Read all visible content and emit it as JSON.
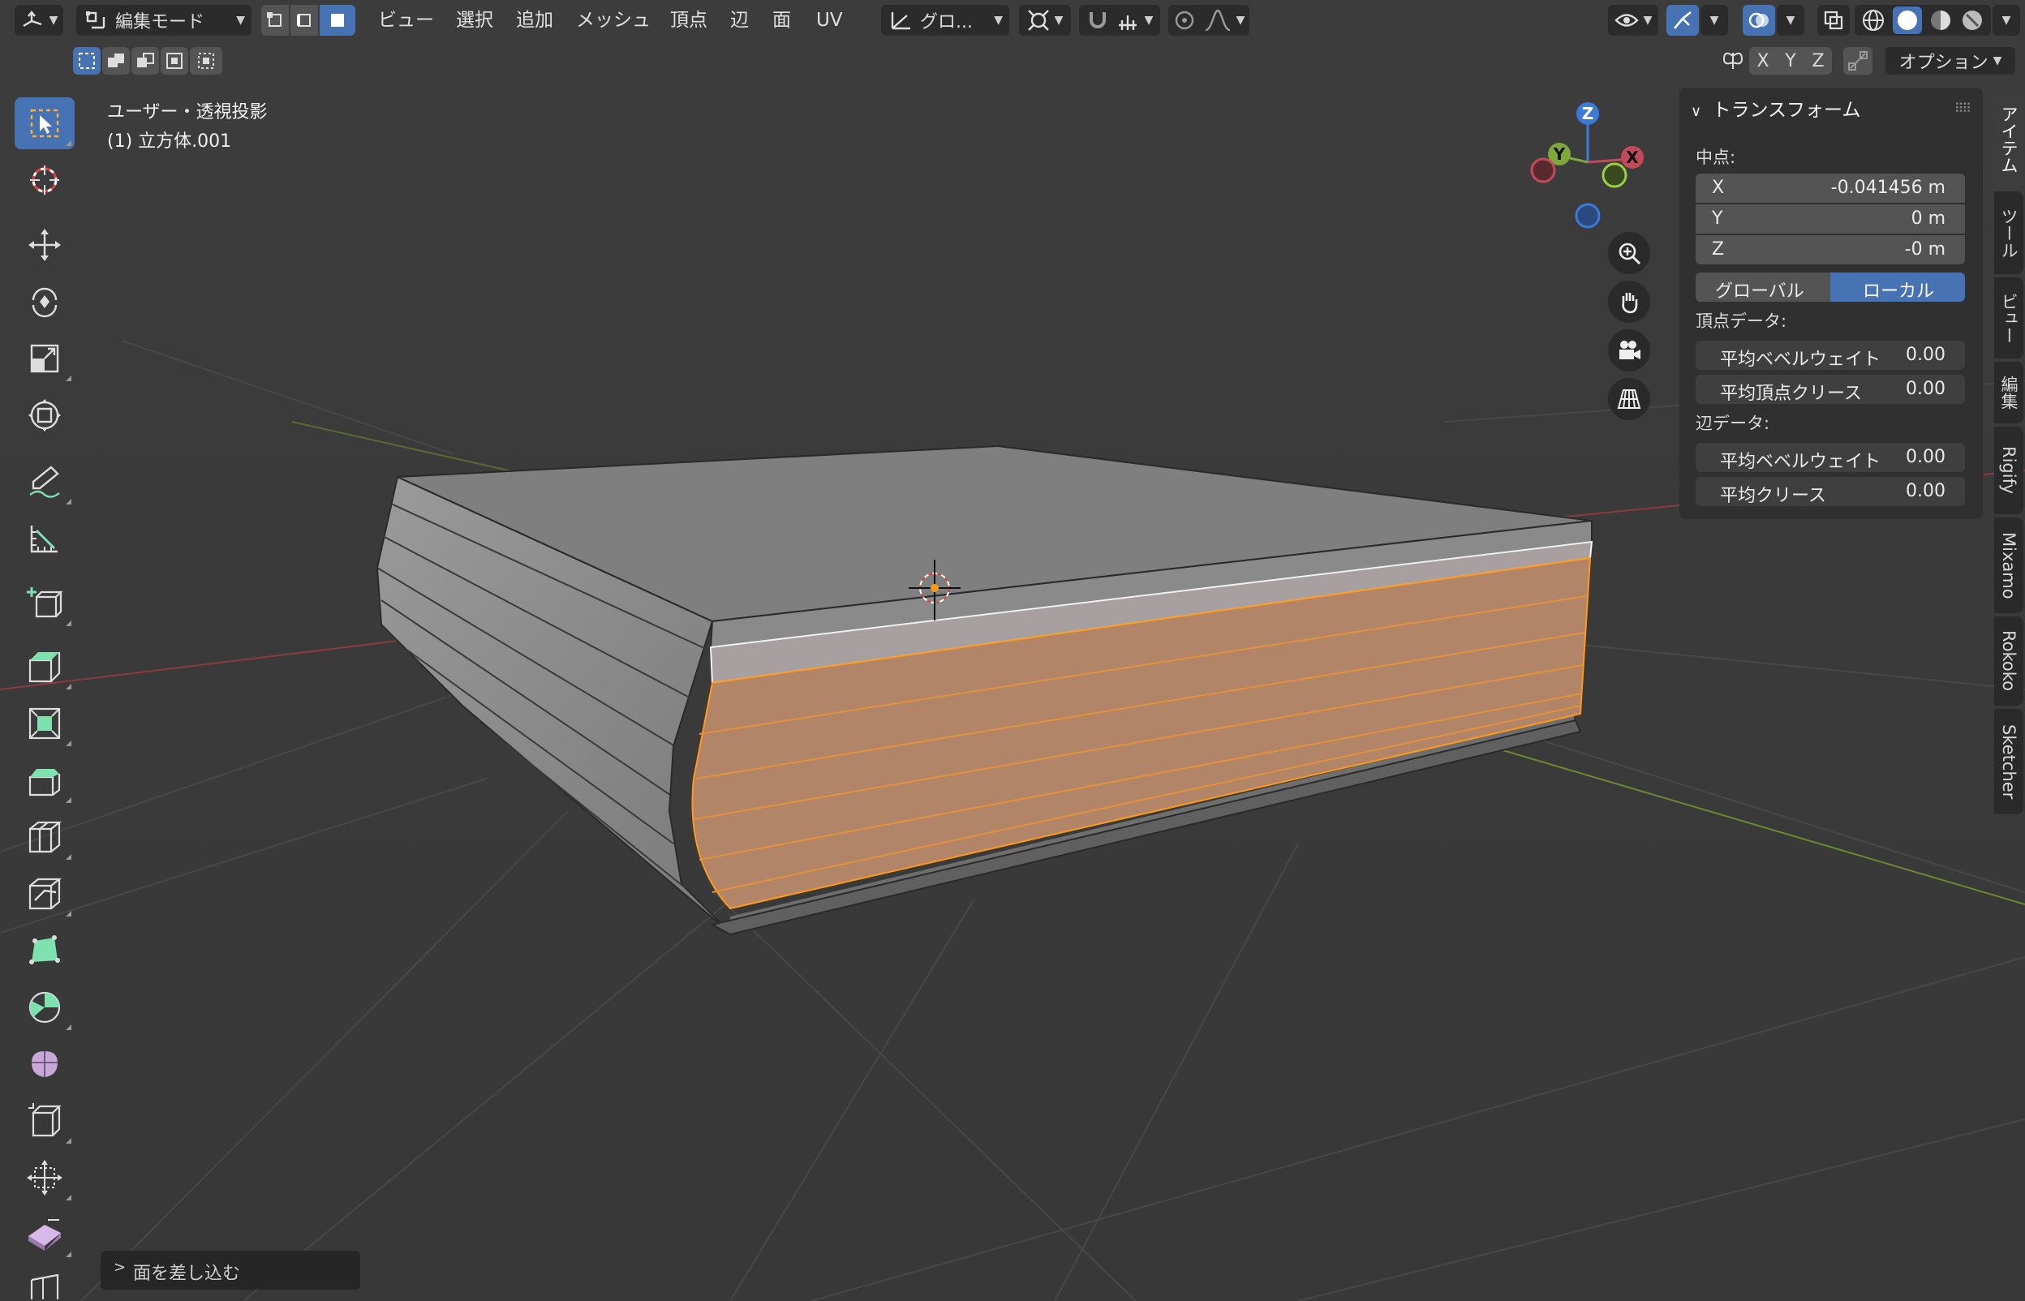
{
  "header": {
    "editor_icon": "3d-viewport-icon",
    "mode_label": "編集モード",
    "select_modes": [
      "vertex-select-icon",
      "edge-select-icon",
      "face-select-icon"
    ],
    "active_select_mode": "face",
    "menus": [
      "ビュー",
      "選択",
      "追加",
      "メッシュ",
      "頂点",
      "辺",
      "面",
      "UV"
    ],
    "transform_orientation": "グロ...",
    "axis_toggles": [
      "X",
      "Y",
      "Z"
    ],
    "options_label": "オプション"
  },
  "viewport": {
    "view_name": "ユーザー・透視投影",
    "object_name": "(1) 立方体.001",
    "gizmo_axes": [
      "Z",
      "Y",
      "X"
    ]
  },
  "colors": {
    "selection_face": "#c08a60",
    "selection_edge": "#ff9a1a",
    "active_blue": "#4772b3",
    "x_axis": "#c44a5a",
    "y_axis": "#7fa83a",
    "z_axis": "#3a7ad8"
  },
  "toolbar": {
    "tools": [
      "select-box-icon",
      "cursor-icon",
      "move-icon",
      "rotate-icon",
      "scale-icon",
      "transform-icon",
      "annotate-icon",
      "measure-icon",
      "add-cube-icon",
      "extrude-icon",
      "inset-icon",
      "bevel-icon",
      "loop-cut-icon",
      "knife-icon",
      "poly-build-icon",
      "spin-icon",
      "smooth-icon",
      "edge-slide-icon",
      "shrink-fatten-icon",
      "shear-icon",
      "rip-icon"
    ]
  },
  "npanel": {
    "title": "トランスフォーム",
    "median_label": "中点:",
    "x_label": "X",
    "x_value": "-0.041456 m",
    "y_label": "Y",
    "y_value": "0 m",
    "z_label": "Z",
    "z_value": "-0 m",
    "global_label": "グローバル",
    "local_label": "ローカル",
    "vertex_data_label": "頂点データ:",
    "v_bevel_label": "平均ベベルウェイト",
    "v_bevel_value": "0.00",
    "v_crease_label": "平均頂点クリース",
    "v_crease_value": "0.00",
    "edge_data_label": "辺データ:",
    "e_bevel_label": "平均ベベルウェイト",
    "e_bevel_value": "0.00",
    "e_crease_label": "平均クリース",
    "e_crease_value": "0.00"
  },
  "sidebar_tabs": [
    "アイテム",
    "ツール",
    "ビュー",
    "編集",
    "Rigify",
    "Mixamo",
    "Rokoko",
    "Sketcher"
  ],
  "active_tab": "アイテム",
  "status": {
    "last_operator": "面を差し込む"
  }
}
